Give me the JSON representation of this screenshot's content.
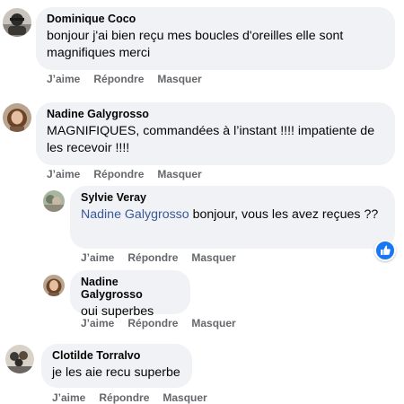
{
  "comments": [
    {
      "author": "Dominique Coco",
      "text": "bonjour j'ai bien reçu mes boucles d'oreilles elle sont magnifiques merci",
      "actions": {
        "like": "J’aime",
        "reply": "Répondre",
        "hide": "Masquer"
      }
    },
    {
      "author": "Nadine Galygrosso",
      "text": "MAGNIFIQUES, commandées à l’instant !!!! impatiente de les recevoir !!!!",
      "actions": {
        "like": "J’aime",
        "reply": "Répondre",
        "hide": "Masquer"
      },
      "replies": [
        {
          "author": "Sylvie Veray",
          "mention": "Nadine Galygrosso",
          "text": " bonjour, vous les avez reçues ??",
          "reaction_icon": "thumbs-up-icon",
          "actions": {
            "like": "J’aime",
            "reply": "Répondre",
            "hide": "Masquer"
          }
        },
        {
          "author": "Nadine Galygrosso",
          "text": "oui superbes",
          "actions": {
            "like": "J’aime",
            "reply": "Répondre",
            "hide": "Masquer"
          }
        }
      ]
    },
    {
      "author": "Clotilde Torralvo",
      "text": "je les aie recu superbe",
      "actions": {
        "like": "J’aime",
        "reply": "Répondre",
        "hide": "Masquer"
      }
    }
  ],
  "colors": {
    "bubble": "#f0f2f5",
    "action_text": "#65676b",
    "mention": "#385898",
    "like_badge": "#1877f2"
  }
}
